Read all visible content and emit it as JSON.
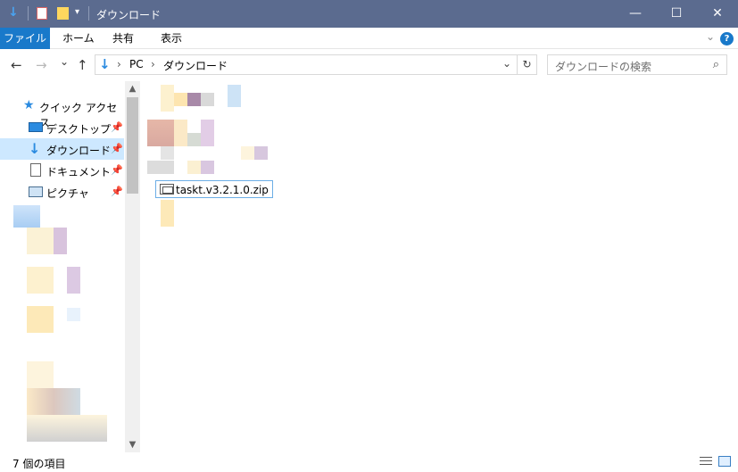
{
  "window": {
    "title": "ダウンロード",
    "minimize": "—",
    "maximize": "☐",
    "close": "✕"
  },
  "quick_access_toolbar": {
    "icons": [
      "download-arrow-icon",
      "properties-icon",
      "new-folder-icon",
      "customize-dropdown-icon"
    ],
    "dropdown": "▾"
  },
  "ribbon": {
    "tabs": [
      "ファイル",
      "ホーム",
      "共有",
      "表示"
    ],
    "help": "?"
  },
  "nav": {
    "back": "←",
    "forward": "→",
    "recent": "⌄",
    "up": "↑",
    "breadcrumb": [
      "PC",
      "ダウンロード"
    ],
    "separator": "›",
    "refresh": "↻",
    "search_placeholder": "ダウンロードの検索"
  },
  "sidebar": {
    "quick_access_label": "クイック アクセス",
    "items": [
      {
        "label": "デスクトップ",
        "icon": "desktop-icon",
        "pinned": true
      },
      {
        "label": "ダウンロード",
        "icon": "download-icon",
        "pinned": true,
        "selected": true
      },
      {
        "label": "ドキュメント",
        "icon": "documents-icon",
        "pinned": true
      },
      {
        "label": "ピクチャ",
        "icon": "pictures-icon",
        "pinned": true
      }
    ]
  },
  "content": {
    "rename_value": "taskt.v3.2.1.0.zip"
  },
  "status": {
    "item_count": "7 個の項目"
  },
  "colors": {
    "titlebar": "#5b6b8f",
    "accent": "#1979ca",
    "selection": "#cde8ff"
  }
}
